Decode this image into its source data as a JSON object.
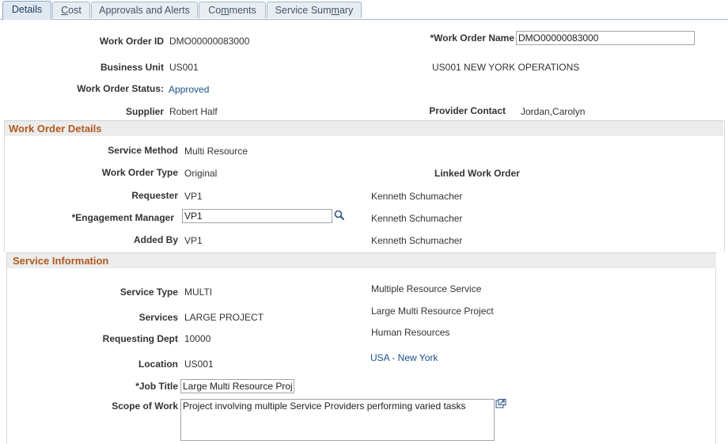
{
  "tabs": {
    "details": "Details",
    "cost_pre": "",
    "cost_u": "C",
    "cost_post": "ost",
    "approvals": "Approvals and Alerts",
    "comments_pre": "Co",
    "comments_u": "m",
    "comments_post": "ments",
    "summary_pre": "Service Sum",
    "summary_u": "m",
    "summary_post": "ary"
  },
  "header": {
    "work_order_id_label": "Work Order ID",
    "work_order_id": "DMO00000083000",
    "work_order_name_label": "*Work Order Name",
    "work_order_name": "DMO00000083000",
    "business_unit_label": "Business Unit",
    "business_unit": "US001",
    "business_unit_desc": "US001 NEW YORK OPERATIONS",
    "status_label": "Work Order Status:",
    "status": "Approved",
    "supplier_label": "Supplier",
    "supplier": "Robert Half",
    "provider_contact_label": "Provider Contact",
    "provider_contact": "Jordan,Carolyn"
  },
  "details": {
    "title": "Work Order Details",
    "service_method_label": "Service Method",
    "service_method": "Multi Resource",
    "work_order_type_label": "Work Order Type",
    "work_order_type": "Original",
    "linked_work_order_label": "Linked Work Order",
    "requester_label": "Requester",
    "requester": "VP1",
    "requester_name": "Kenneth Schumacher",
    "engagement_manager_label": "*Engagement Manager",
    "engagement_manager": "VP1",
    "engagement_manager_name": "Kenneth Schumacher",
    "added_by_label": "Added By",
    "added_by": "VP1",
    "added_by_name": "Kenneth Schumacher"
  },
  "service": {
    "title": "Service Information",
    "service_type_label": "Service Type",
    "service_type": "MULTI",
    "service_type_desc": "Multiple Resource Service",
    "services_label": "Services",
    "services": "LARGE PROJECT",
    "services_desc": "Large Multi Resource Project",
    "requesting_dept_label": "Requesting Dept",
    "requesting_dept": "10000",
    "requesting_dept_desc": "Human Resources",
    "location_label": "Location",
    "location": "US001",
    "location_desc": "USA - New York",
    "job_title_label": "*Job Title",
    "job_title": "Large Multi Resource Proj",
    "scope_label": "Scope of Work",
    "scope": "Project involving multiple Service Providers performing varied tasks"
  },
  "colors": {
    "section_title": "#b05a1c",
    "link": "#1a4f8b",
    "tab_bg": "#e8edf2"
  },
  "icons": {
    "lookup": "magnifier-icon",
    "expand": "expand-popup-icon"
  }
}
